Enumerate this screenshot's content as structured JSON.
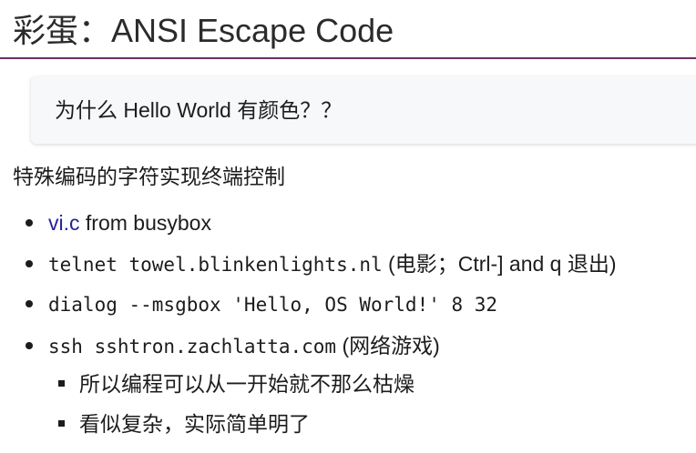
{
  "slide": {
    "title": "彩蛋：ANSI Escape Code",
    "callout": "为什么 Hello World 有颜色？？",
    "intro": "特殊编码的字符实现终端控制",
    "items": [
      {
        "link": "vi.c",
        "text": " from busybox"
      },
      {
        "code": "telnet towel.blinkenlights.nl",
        "text": " (电影；Ctrl-] and q 退出)"
      },
      {
        "code": "dialog --msgbox 'Hello, OS World!' 8 32"
      },
      {
        "code": "ssh sshtron.zachlatta.com",
        "text": " (网络游戏)"
      }
    ],
    "subitems": [
      "所以编程可以从一开始就不那么枯燥",
      "看似复杂，实际简单明了"
    ]
  },
  "colors": {
    "title_rule": "#6a2f62",
    "link": "#25239b",
    "callout_bg": "#f6f8fa"
  }
}
